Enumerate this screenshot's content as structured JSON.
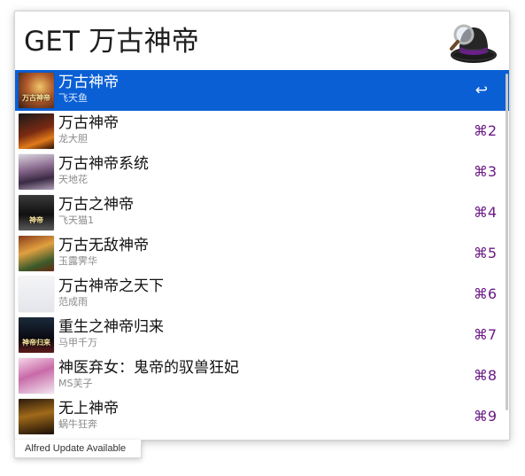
{
  "search": {
    "query": "GET 万古神帝"
  },
  "app": {
    "hat_icon": "alfred-hat-icon",
    "accent": "#0a5fd4",
    "shortcut_color": "#6b1a84"
  },
  "results": [
    {
      "title": "万古神帝",
      "subtitle": "飞天鱼",
      "shortcut": "↩",
      "thumb_text": "万古神帝",
      "selected": true
    },
    {
      "title": "万古神帝",
      "subtitle": "龙大胆",
      "shortcut": "⌘2",
      "thumb_text": ""
    },
    {
      "title": "万古神帝系统",
      "subtitle": "天地花",
      "shortcut": "⌘3",
      "thumb_text": ""
    },
    {
      "title": "万古之神帝",
      "subtitle": "飞天猫1",
      "shortcut": "⌘4",
      "thumb_text": "神帝"
    },
    {
      "title": "万古无敌神帝",
      "subtitle": "玉露霁华",
      "shortcut": "⌘5",
      "thumb_text": ""
    },
    {
      "title": "万古神帝之天下",
      "subtitle": "范成雨",
      "shortcut": "⌘6",
      "thumb_text": ""
    },
    {
      "title": "重生之神帝归来",
      "subtitle": "马甲千万",
      "shortcut": "⌘7",
      "thumb_text": "神帝归来"
    },
    {
      "title": "神医弃女：鬼帝的驭兽狂妃",
      "subtitle": "MS芙子",
      "shortcut": "⌘8",
      "thumb_text": ""
    },
    {
      "title": "无上神帝",
      "subtitle": "蜗牛狂奔",
      "shortcut": "⌘9",
      "thumb_text": ""
    }
  ],
  "footer": {
    "update_label": "Alfred Update Available"
  }
}
